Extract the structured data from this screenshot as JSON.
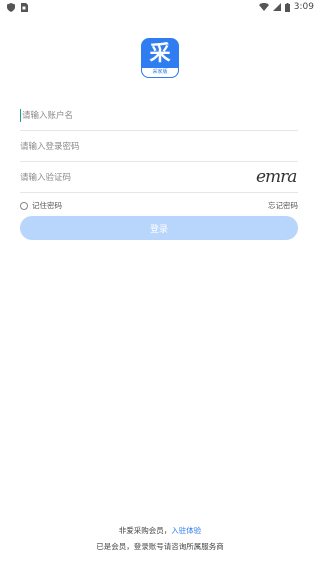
{
  "status_bar": {
    "time": "3:09"
  },
  "logo": {
    "glyph": "采",
    "sub_label": "采家版"
  },
  "form": {
    "username_placeholder": "请输入账户名",
    "password_placeholder": "请输入登录密码",
    "captcha_placeholder": "请输入验证码",
    "captcha_text": "emra",
    "remember_label": "记住密码",
    "forgot_label": "忘记密码",
    "login_label": "登录"
  },
  "footer": {
    "not_member_text": "非爱采购会员，",
    "join_link": "入驻体验",
    "member_text": "已是会员，登录账号请咨询所属服务商"
  },
  "colors": {
    "brand_blue": "#2f7df0",
    "button_disabled": "#b8d5fb"
  }
}
